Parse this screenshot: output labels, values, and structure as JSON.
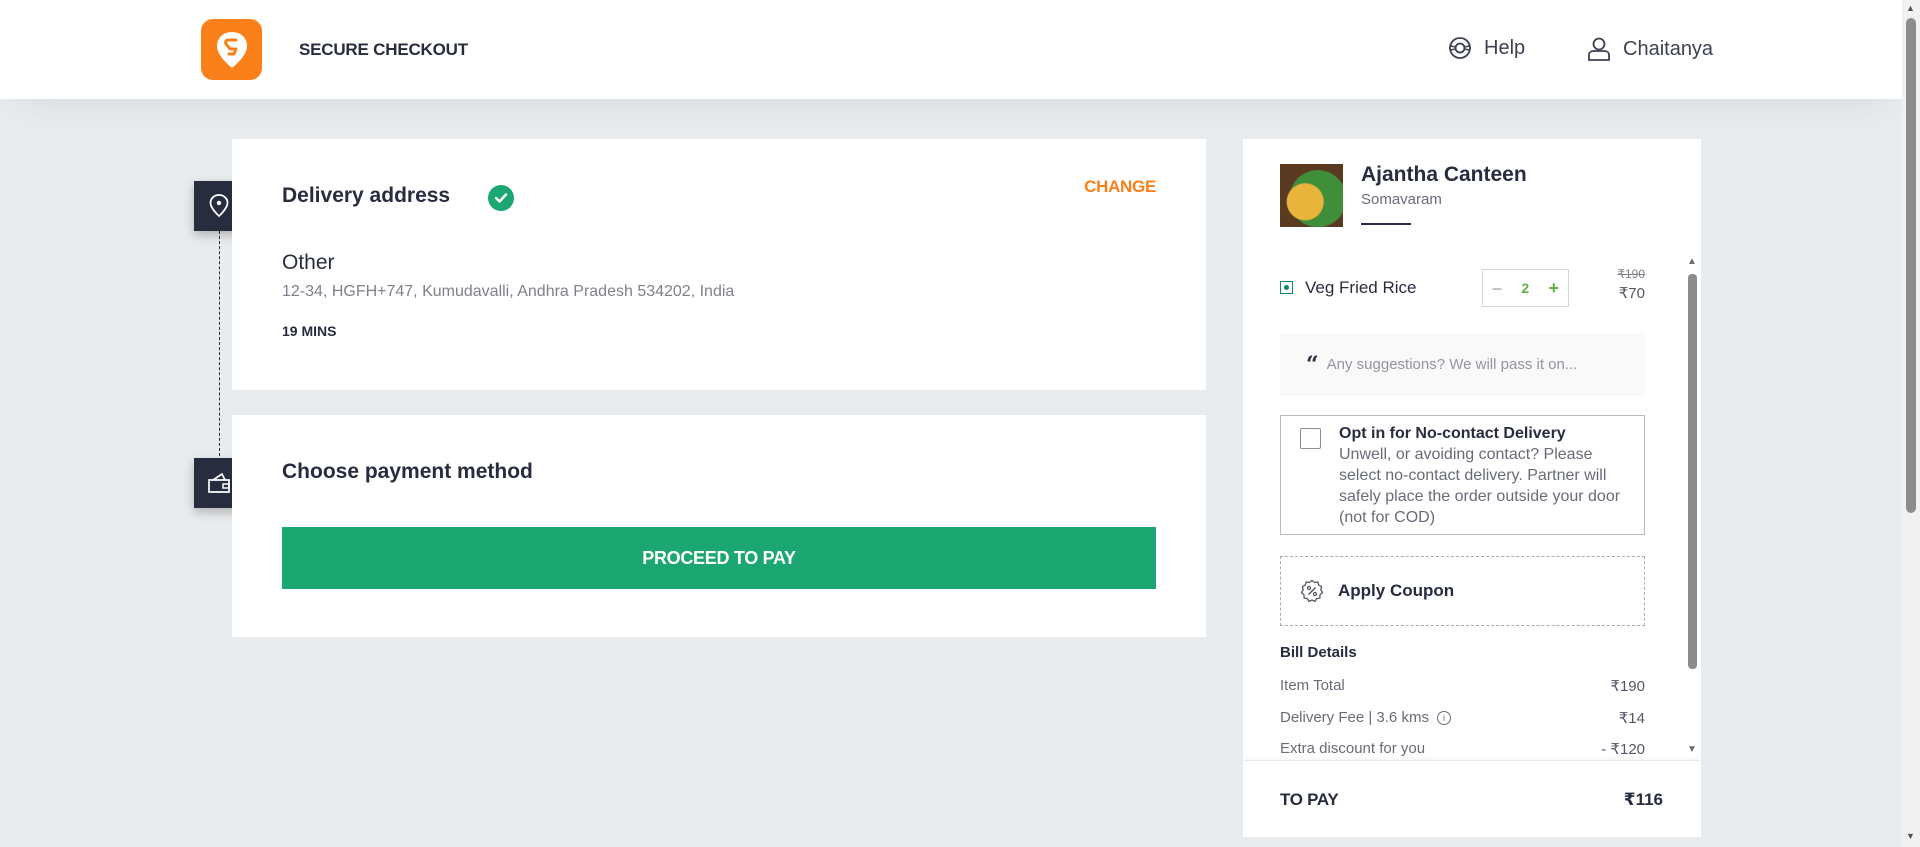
{
  "header": {
    "title": "SECURE CHECKOUT",
    "help_label": "Help",
    "user_name": "Chaitanya",
    "brand_color": "#fc8019"
  },
  "delivery": {
    "title": "Delivery address",
    "change_label": "CHANGE",
    "address_type": "Other",
    "address": "12-34, HGFH+747, Kumudavalli, Andhra Pradesh 534202, India",
    "eta": "19 MINS"
  },
  "payment": {
    "title": "Choose payment method",
    "proceed_label": "PROCEED TO PAY",
    "accent_color": "#1ba672"
  },
  "cart": {
    "restaurant_name": "Ajantha Canteen",
    "restaurant_area": "Somavaram",
    "items": [
      {
        "name": "Veg Fried Rice",
        "qty": "2",
        "price_old": "₹190",
        "price_new": "₹70",
        "veg": true
      }
    ],
    "suggestion_placeholder": "Any suggestions? We will pass it on...",
    "no_contact": {
      "title": "Opt in for No-contact Delivery",
      "description": "Unwell, or avoiding contact? Please select no-contact delivery. Partner will safely place the order outside your door (not for COD)",
      "checked": false
    },
    "coupon_label": "Apply Coupon",
    "bill": {
      "title": "Bill Details",
      "rows": [
        {
          "label": "Item Total",
          "value": "₹190"
        },
        {
          "label": "Delivery Fee | 3.6 kms",
          "value": "₹14"
        },
        {
          "label": "Extra discount for you",
          "value": "- ₹120"
        }
      ]
    },
    "to_pay_label": "TO PAY",
    "to_pay_value": "₹116"
  }
}
